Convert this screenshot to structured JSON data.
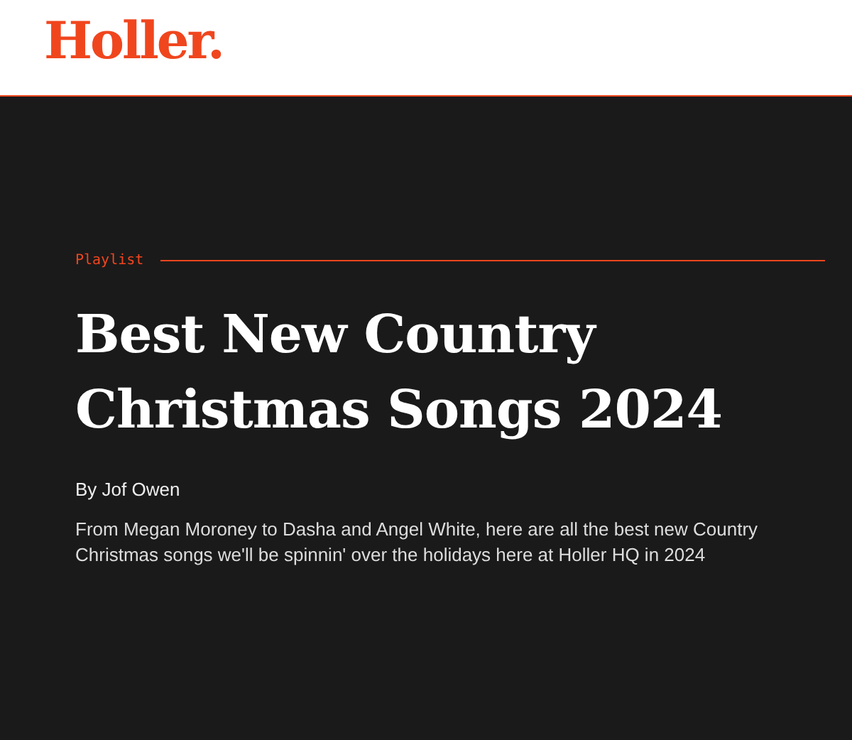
{
  "header": {
    "logo": "Holler."
  },
  "article": {
    "category": "Playlist",
    "title": "Best New Country Christmas Songs 2024",
    "byline": "By Jof Owen",
    "description": "From Megan Moroney to Dasha and Angel White, here are all the best new Country Christmas songs we'll be spinnin' over the holidays here at Holler HQ in 2024"
  }
}
